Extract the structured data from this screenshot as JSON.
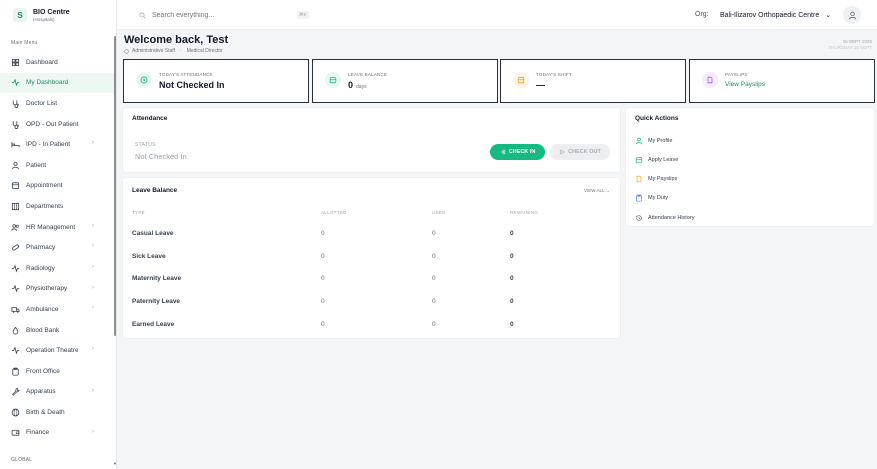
{
  "brand": {
    "logo": "S",
    "name": "BIO Centre",
    "sub": "(Hospitals)"
  },
  "sidebar": {
    "section_main": "Main Menu",
    "section_global": "GLOBAL",
    "items": [
      {
        "label": "Dashboard",
        "icon": "grid-icon",
        "chevron": false
      },
      {
        "label": "My Dashboard",
        "icon": "activity-icon",
        "chevron": false,
        "active": true
      },
      {
        "label": "Doctor List",
        "icon": "stethoscope-icon",
        "chevron": false
      },
      {
        "label": "OPD - Out Patient",
        "icon": "stethoscope-icon",
        "chevron": false
      },
      {
        "label": "IPD - In Patient",
        "icon": "bed-icon",
        "chevron": true
      },
      {
        "label": "Patient",
        "icon": "user-icon",
        "chevron": false
      },
      {
        "label": "Appointment",
        "icon": "calendar-icon",
        "chevron": false
      },
      {
        "label": "Departments",
        "icon": "building-icon",
        "chevron": false
      },
      {
        "label": "HR Management",
        "icon": "users-icon",
        "chevron": true
      },
      {
        "label": "Pharmacy",
        "icon": "pill-icon",
        "chevron": true
      },
      {
        "label": "Radiology",
        "icon": "activity-icon",
        "chevron": true
      },
      {
        "label": "Physiotherapy",
        "icon": "activity-icon",
        "chevron": true
      },
      {
        "label": "Ambulance",
        "icon": "truck-icon",
        "chevron": true
      },
      {
        "label": "Blood Bank",
        "icon": "droplet-icon",
        "chevron": false
      },
      {
        "label": "Operation Theatre",
        "icon": "activity-icon",
        "chevron": true
      },
      {
        "label": "Front Office",
        "icon": "clipboard-icon",
        "chevron": false
      },
      {
        "label": "Apparatus",
        "icon": "wrench-icon",
        "chevron": true
      },
      {
        "label": "Birth & Death",
        "icon": "globe-icon",
        "chevron": false
      },
      {
        "label": "Finance",
        "icon": "wallet-icon",
        "chevron": true
      }
    ]
  },
  "topbar": {
    "search_placeholder": "Search everything...",
    "shortcut": "⌘K",
    "org_label": "Org:",
    "org_value": "Bali-Ilizarov Orthopaedic Centre"
  },
  "header": {
    "welcome": "Welcome back, Test",
    "role": "Administrative Staff",
    "department": "Medical Director",
    "date_top": "15 SEPT 2025",
    "date_bottom": "THURSDAY 15 SEPT"
  },
  "stats": [
    {
      "label": "TODAY'S ATTENDANCE",
      "value": "Not Checked In",
      "icon": "clock-icon",
      "color": "#16b981",
      "bg": "#e7f7f0"
    },
    {
      "label": "LEAVE BALANCE",
      "value": "0",
      "unit": "days",
      "icon": "calendar-icon",
      "color": "#16b981",
      "bg": "#e7f7f0"
    },
    {
      "label": "TODAY'S SHIFT",
      "value": "—",
      "icon": "calendar-icon",
      "color": "#f59e0b",
      "bg": "#fef3e2"
    },
    {
      "label": "PAYSLIPS",
      "link": "View Payslips",
      "icon": "file-icon",
      "color": "#a855f7",
      "bg": "#f5ecfe"
    }
  ],
  "attendance": {
    "title": "Attendance",
    "status_label": "STATUS",
    "status_value": "Not Checked In",
    "check_in": "CHECK IN",
    "check_out": "CHECK OUT"
  },
  "leave": {
    "title": "Leave Balance",
    "view_all": "VIEW ALL →",
    "headers": [
      "TYPE",
      "ALLOTTED",
      "USED",
      "REMAINING"
    ],
    "rows": [
      {
        "type": "Casual Leave",
        "allotted": "0",
        "used": "0",
        "remaining": "0"
      },
      {
        "type": "Sick Leave",
        "allotted": "0",
        "used": "0",
        "remaining": "0"
      },
      {
        "type": "Maternity Leave",
        "allotted": "0",
        "used": "0",
        "remaining": "0"
      },
      {
        "type": "Paternity Leave",
        "allotted": "0",
        "used": "0",
        "remaining": "0"
      },
      {
        "type": "Earned Leave",
        "allotted": "0",
        "used": "0",
        "remaining": "0"
      }
    ]
  },
  "quick_actions": {
    "title": "Quick Actions",
    "items": [
      {
        "label": "My Profile",
        "icon": "user-icon",
        "color": "#16b981"
      },
      {
        "label": "Apply Leave",
        "icon": "calendar-icon",
        "color": "#16b981"
      },
      {
        "label": "My Payslips",
        "icon": "file-icon",
        "color": "#f59e0b"
      },
      {
        "label": "My Duty",
        "icon": "clipboard-icon",
        "color": "#3b82f6"
      },
      {
        "label": "Attendance History",
        "icon": "history-icon",
        "color": "#6b7280"
      }
    ]
  }
}
